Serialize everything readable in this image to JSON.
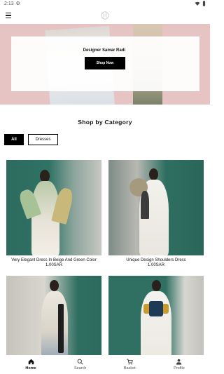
{
  "status_bar": {
    "time": "2:13"
  },
  "hero": {
    "title": "Designer Samar Radi",
    "cta_label": "Shop Now"
  },
  "shop": {
    "section_title": "Shop by Category",
    "filters": [
      {
        "label": "All",
        "selected": true
      },
      {
        "label": "Dresses",
        "selected": false
      }
    ],
    "products": [
      {
        "name": "Very Elegant Dress In Beige And Green Color",
        "price": "1.00SAR"
      },
      {
        "name": "Unique Design Shoulders Dress",
        "price": "1.00SAR"
      }
    ]
  },
  "bottom_nav": {
    "items": [
      {
        "label": "Home",
        "icon": "home-icon",
        "active": true
      },
      {
        "label": "Search",
        "icon": "search-icon",
        "active": false
      },
      {
        "label": "Basket",
        "icon": "cart-icon",
        "active": false
      },
      {
        "label": "Profile",
        "icon": "person-icon",
        "active": false
      }
    ]
  },
  "colors": {
    "hero_bg": "#e7c4c4",
    "accent": "#000000",
    "tile_green": "#2f7062"
  }
}
